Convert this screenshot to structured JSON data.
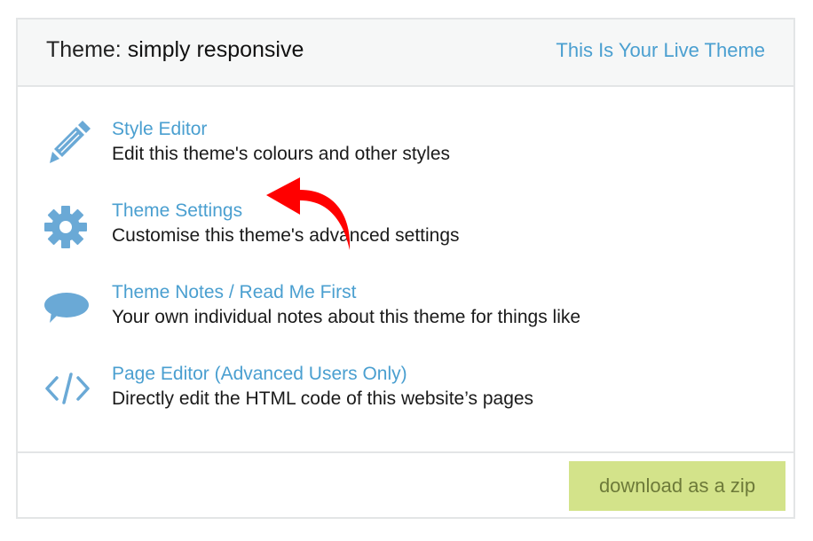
{
  "header": {
    "title_prefix": "Theme: ",
    "theme_name": "simply responsive",
    "live_link": "This Is Your Live Theme"
  },
  "items": [
    {
      "icon": "pencil-icon",
      "label": "Style Editor",
      "description": "Edit this theme's colours and other styles"
    },
    {
      "icon": "gear-icon",
      "label": "Theme Settings",
      "description": "Customise this theme's advanced settings"
    },
    {
      "icon": "speech-bubble-icon",
      "label": "Theme Notes / Read Me First",
      "description": "Your own individual notes about this theme for things like"
    },
    {
      "icon": "code-icon",
      "label": "Page Editor (Advanced Users Only)",
      "description": "Directly edit the HTML code of this website’s pages"
    }
  ],
  "footer": {
    "download_label": "download as a zip"
  },
  "colors": {
    "link": "#4a9fd0",
    "icon": "#6aa9d6",
    "download_bg": "#d3e38a",
    "annotation_arrow": "#ff0000"
  }
}
